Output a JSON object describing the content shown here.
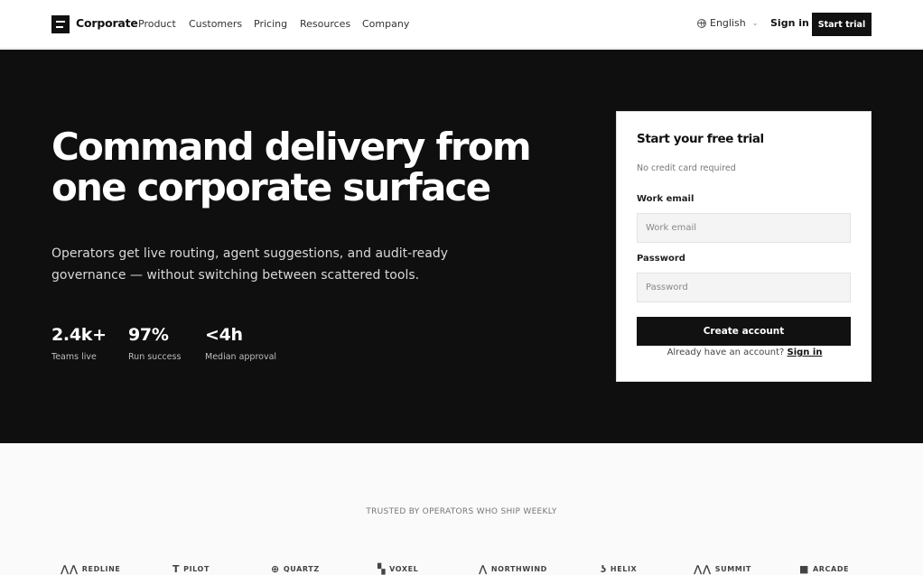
{
  "nav": {
    "brand": "Corporate",
    "links": [
      "Product",
      "Customers",
      "Pricing",
      "Resources",
      "Company"
    ],
    "language": "English",
    "sign_in": "Sign in",
    "start_trial": "Start trial"
  },
  "hero": {
    "title": "Command delivery from one corporate surface",
    "subtitle": "Operators get live routing, agent suggestions, and audit-ready governance — without switching between scattered tools.",
    "stats": [
      {
        "value": "2.4k+",
        "label": "Teams live"
      },
      {
        "value": "97%",
        "label": "Run success"
      },
      {
        "value": "<4h",
        "label": "Median approval"
      }
    ]
  },
  "signup": {
    "title": "Start your free trial",
    "note": "No credit card required",
    "email_label": "Work email",
    "email_placeholder": "Work email",
    "password_label": "Password",
    "password_placeholder": "Password",
    "submit": "Create account",
    "already_text": "Already have an account?",
    "sign_in_link": "Sign in"
  },
  "trusted": {
    "heading": "TRUSTED BY OPERATORS WHO SHIP WEEKLY",
    "brands": [
      {
        "name": "REDLINE",
        "icon": "mountain-icon"
      },
      {
        "name": "PILOT",
        "icon": "t-icon"
      },
      {
        "name": "QUARTZ",
        "icon": "crosshair-icon"
      },
      {
        "name": "VOXEL",
        "icon": "grid-icon"
      },
      {
        "name": "NORTHWIND",
        "icon": "mountain-icon"
      },
      {
        "name": "HELIX",
        "icon": "helix-icon"
      },
      {
        "name": "SUMMIT",
        "icon": "mountain-icon"
      },
      {
        "name": "ARCADE",
        "icon": "square-icon"
      }
    ]
  }
}
